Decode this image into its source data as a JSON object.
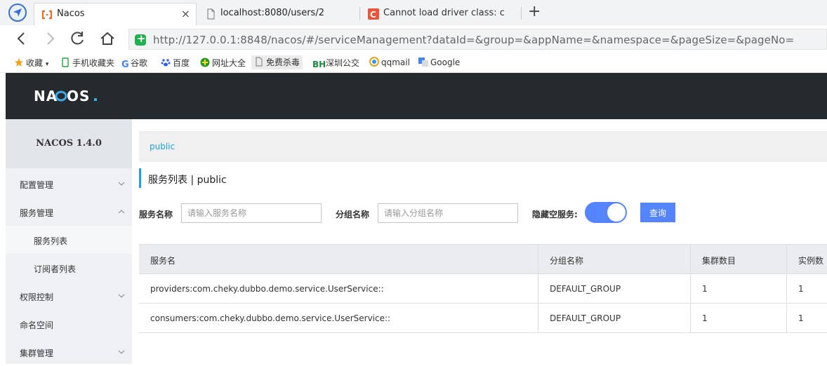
{
  "browser": {
    "tabs": [
      {
        "title": "Nacos",
        "active": true
      },
      {
        "title": "localhost:8080/users/2",
        "active": false
      },
      {
        "title": "Cannot load driver class: com",
        "active": false
      }
    ],
    "url": "http://127.0.0.1:8848/nacos/#/serviceManagement?dataId=&group=&appName=&namespace=&pageSize=&pageNo=",
    "bookmarks": [
      "收藏",
      "手机收藏夹",
      "谷歌",
      "百度",
      "网址大全",
      "免费杀毒",
      "深圳公交",
      "qqmail",
      "Google"
    ]
  },
  "app": {
    "logo": "NACOS.",
    "version": "NACOS 1.4.0",
    "sidebar": [
      {
        "label": "配置管理",
        "chevron": "down"
      },
      {
        "label": "服务管理",
        "chevron": "up"
      },
      {
        "label": "服务列表",
        "sub": true
      },
      {
        "label": "订阅者列表",
        "sub": true
      },
      {
        "label": "权限控制",
        "chevron": "down"
      },
      {
        "label": "命名空间"
      },
      {
        "label": "集群管理",
        "chevron": "down"
      }
    ],
    "namespace": "public",
    "page_title": "服务列表  |  public",
    "filters": {
      "service_name_label": "服务名称",
      "service_name_placeholder": "请输入服务名称",
      "group_name_label": "分组名称",
      "group_name_placeholder": "请输入分组名称",
      "hide_empty_label": "隐藏空服务:",
      "hide_empty_on": true,
      "query_label": "查询"
    },
    "table": {
      "headers": [
        "服务名",
        "分组名称",
        "集群数目",
        "实例数"
      ],
      "rows": [
        [
          "providers:com.cheky.dubbo.demo.service.UserService::",
          "DEFAULT_GROUP",
          "1",
          "1"
        ],
        [
          "consumers:com.cheky.dubbo.demo.service.UserService::",
          "DEFAULT_GROUP",
          "1",
          "1"
        ]
      ]
    }
  },
  "colors": {
    "header_bg": "#252a2f",
    "accent": "#5584ff",
    "link": "#1aa1e4",
    "title_bar": "#209bfa"
  }
}
